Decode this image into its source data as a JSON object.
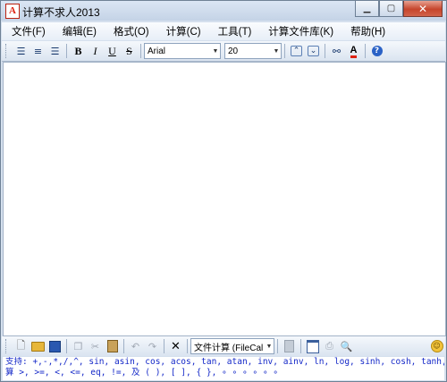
{
  "window": {
    "title": "计算不求人2013",
    "icon_letter": "A"
  },
  "menu": [
    "文件(F)",
    "编辑(E)",
    "格式(O)",
    "计算(C)",
    "工具(T)",
    "计算文件库(K)",
    "帮助(H)"
  ],
  "format_toolbar": {
    "font_name": "Arial",
    "font_size": "20",
    "bold": "B",
    "italic": "I",
    "underline": "U",
    "strike": "S",
    "font_color_letter": "A"
  },
  "bottom_toolbar": {
    "mode_select": "文件计算 (FileCal"
  },
  "help": {
    "line1": "支持: +,-,*,/,^, sin, asin, cos, acos, tan, atan, inv, ainv, ln, log, sinh, cosh, tanh, calvol, outprg 和比较运",
    "line2": "算 >, >=, <, <=, eq, !=,  及 ( ), [ ], { }, ∘ ∘ ∘ ∘ ∘ ∘"
  },
  "colors": {
    "help_text": "#1428c8",
    "accent": "#d21"
  }
}
